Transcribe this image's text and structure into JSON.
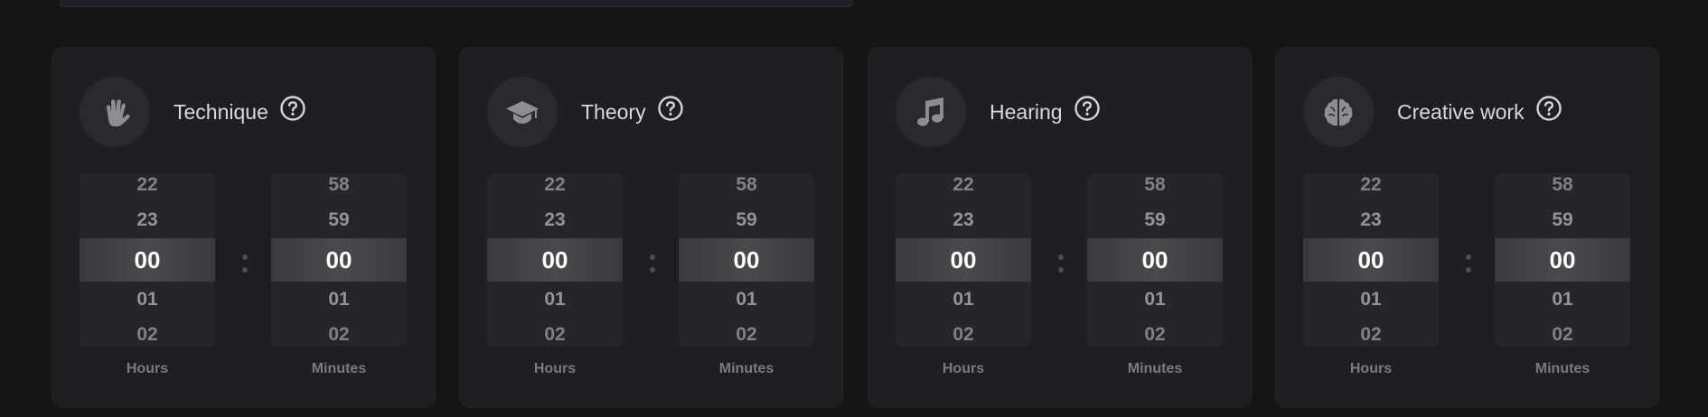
{
  "cards": [
    {
      "title": "Technique",
      "icon": "hand-icon",
      "hours": {
        "above": [
          "22",
          "23"
        ],
        "selected": "00",
        "below": [
          "01",
          "02"
        ],
        "label": "Hours"
      },
      "minutes": {
        "above": [
          "58",
          "59"
        ],
        "selected": "00",
        "below": [
          "01",
          "02"
        ],
        "label": "Minutes"
      }
    },
    {
      "title": "Theory",
      "icon": "graduation-cap-icon",
      "hours": {
        "above": [
          "22",
          "23"
        ],
        "selected": "00",
        "below": [
          "01",
          "02"
        ],
        "label": "Hours"
      },
      "minutes": {
        "above": [
          "58",
          "59"
        ],
        "selected": "00",
        "below": [
          "01",
          "02"
        ],
        "label": "Minutes"
      }
    },
    {
      "title": "Hearing",
      "icon": "music-note-icon",
      "hours": {
        "above": [
          "22",
          "23"
        ],
        "selected": "00",
        "below": [
          "01",
          "02"
        ],
        "label": "Hours"
      },
      "minutes": {
        "above": [
          "58",
          "59"
        ],
        "selected": "00",
        "below": [
          "01",
          "02"
        ],
        "label": "Minutes"
      }
    },
    {
      "title": "Creative work",
      "icon": "brain-icon",
      "hours": {
        "above": [
          "22",
          "23"
        ],
        "selected": "00",
        "below": [
          "01",
          "02"
        ],
        "label": "Hours"
      },
      "minutes": {
        "above": [
          "58",
          "59"
        ],
        "selected": "00",
        "below": [
          "01",
          "02"
        ],
        "label": "Minutes"
      }
    }
  ],
  "colors": {
    "background": "#151516",
    "card": "#1f1f21",
    "picker": "#262628",
    "selected_row": "#444446",
    "icon": "#8e8e91",
    "help_icon": "#d4d4d6",
    "title_text": "#d9d9db",
    "label_text": "#7b7b7e"
  }
}
